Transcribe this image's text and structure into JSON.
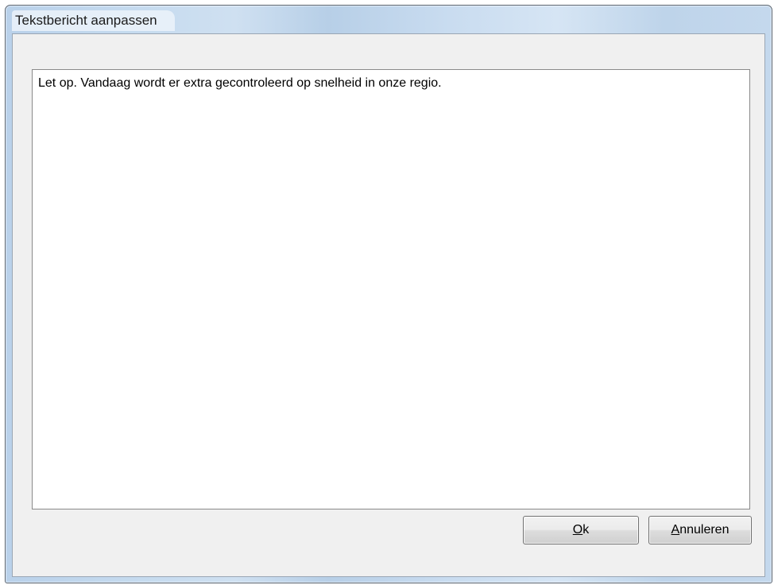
{
  "window": {
    "title": "Tekstbericht aanpassen"
  },
  "editor": {
    "value": "Let op. Vandaag wordt er extra gecontroleerd op snelheid in onze regio."
  },
  "buttons": {
    "ok": {
      "accel": "O",
      "rest": "k"
    },
    "cancel": {
      "accel": "A",
      "rest": "nnuleren"
    }
  },
  "colors": {
    "frame": "#c6dbef",
    "client": "#f0f0f0",
    "button": "#e5e5e5"
  }
}
